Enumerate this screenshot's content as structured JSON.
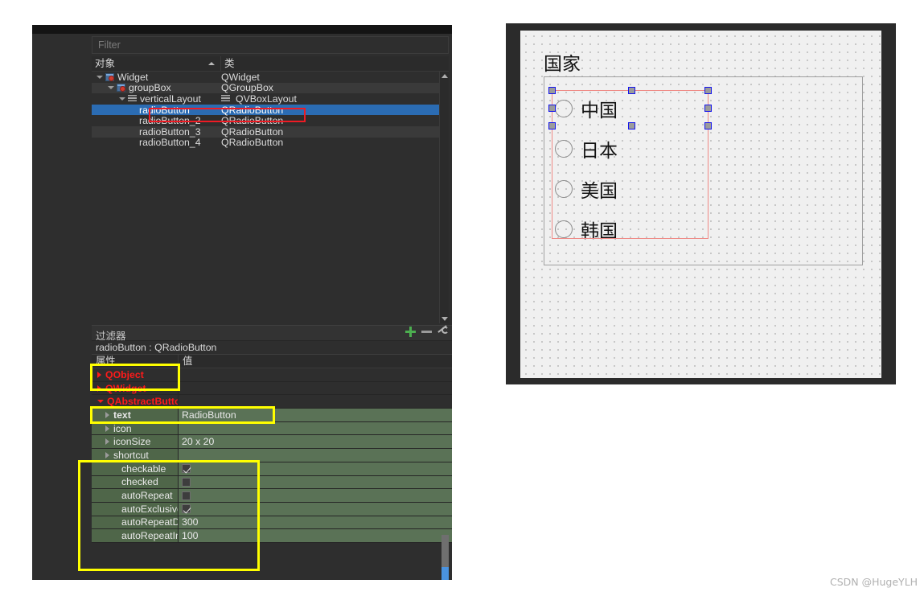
{
  "object_inspector": {
    "filter_placeholder": "Filter",
    "columns": [
      "对象",
      "类"
    ],
    "rows": [
      {
        "name": "Widget",
        "cls": "QWidget",
        "depth": 0,
        "twisty": "open",
        "icon": "widget-icon",
        "cls_icon": "none",
        "state": "normal"
      },
      {
        "name": "groupBox",
        "cls": "QGroupBox",
        "depth": 1,
        "twisty": "open",
        "icon": "widget-icon",
        "cls_icon": "none",
        "state": "alt"
      },
      {
        "name": "verticalLayout",
        "cls": "QVBoxLayout",
        "depth": 2,
        "twisty": "open",
        "icon": "layout-icon",
        "cls_icon": "layout-icon",
        "state": "normal"
      },
      {
        "name": "radioButton",
        "cls": "QRadioButton",
        "depth": 3,
        "twisty": "none",
        "icon": "none",
        "cls_icon": "none",
        "state": "selected"
      },
      {
        "name": "radioButton_2",
        "cls": "QRadioButton",
        "depth": 3,
        "twisty": "none",
        "icon": "none",
        "cls_icon": "none",
        "state": "normal"
      },
      {
        "name": "radioButton_3",
        "cls": "QRadioButton",
        "depth": 3,
        "twisty": "none",
        "icon": "none",
        "cls_icon": "none",
        "state": "alt"
      },
      {
        "name": "radioButton_4",
        "cls": "QRadioButton",
        "depth": 3,
        "twisty": "none",
        "icon": "none",
        "cls_icon": "none",
        "state": "normal"
      }
    ]
  },
  "filter_bar": {
    "label": "过滤器",
    "icons": [
      "plus-icon",
      "minus-icon",
      "wrench-icon"
    ]
  },
  "property_editor": {
    "subject": "radioButton : QRadioButton",
    "columns": [
      "属性",
      "值"
    ],
    "rows": [
      {
        "key": "QObject",
        "value": "",
        "kind": "group",
        "twisty": "collapsed",
        "indent": 0
      },
      {
        "key": "QWidget",
        "value": "",
        "kind": "group",
        "twisty": "collapsed",
        "indent": 0
      },
      {
        "key": "QAbstractButton",
        "value": "",
        "kind": "group",
        "twisty": "open",
        "indent": 0
      },
      {
        "key": "text",
        "value": "RadioButton",
        "kind": "green",
        "twisty": "collapsed",
        "indent": 1,
        "bold": true
      },
      {
        "key": "icon",
        "value": "",
        "kind": "green",
        "twisty": "collapsed",
        "indent": 1
      },
      {
        "key": "iconSize",
        "value": "20 x 20",
        "kind": "green",
        "twisty": "collapsed",
        "indent": 1
      },
      {
        "key": "shortcut",
        "value": "",
        "kind": "green",
        "twisty": "collapsed",
        "indent": 1
      },
      {
        "key": "checkable",
        "value": "",
        "kind": "green",
        "twisty": "none",
        "indent": 2,
        "checkbox": "checked"
      },
      {
        "key": "checked",
        "value": "",
        "kind": "green",
        "twisty": "none",
        "indent": 2,
        "checkbox": "unchecked"
      },
      {
        "key": "autoRepeat",
        "value": "",
        "kind": "green",
        "twisty": "none",
        "indent": 2,
        "checkbox": "unchecked"
      },
      {
        "key": "autoExclusive",
        "value": "",
        "kind": "green",
        "twisty": "none",
        "indent": 2,
        "checkbox": "checked"
      },
      {
        "key": "autoRepeatDe...",
        "value": "300",
        "kind": "green",
        "twisty": "none",
        "indent": 2
      },
      {
        "key": "autoRepeatInt...",
        "value": "100",
        "kind": "green",
        "twisty": "none",
        "indent": 2
      }
    ]
  },
  "form_designer": {
    "groupbox_title": "国家",
    "radios": [
      {
        "label": "中国"
      },
      {
        "label": "日本"
      },
      {
        "label": "美国"
      },
      {
        "label": "韩国"
      }
    ]
  },
  "annotations": {
    "highlight_color_red": "#ee1b24",
    "highlight_color_yellow": "#ffff00"
  },
  "watermark": "CSDN @HugeYLH"
}
